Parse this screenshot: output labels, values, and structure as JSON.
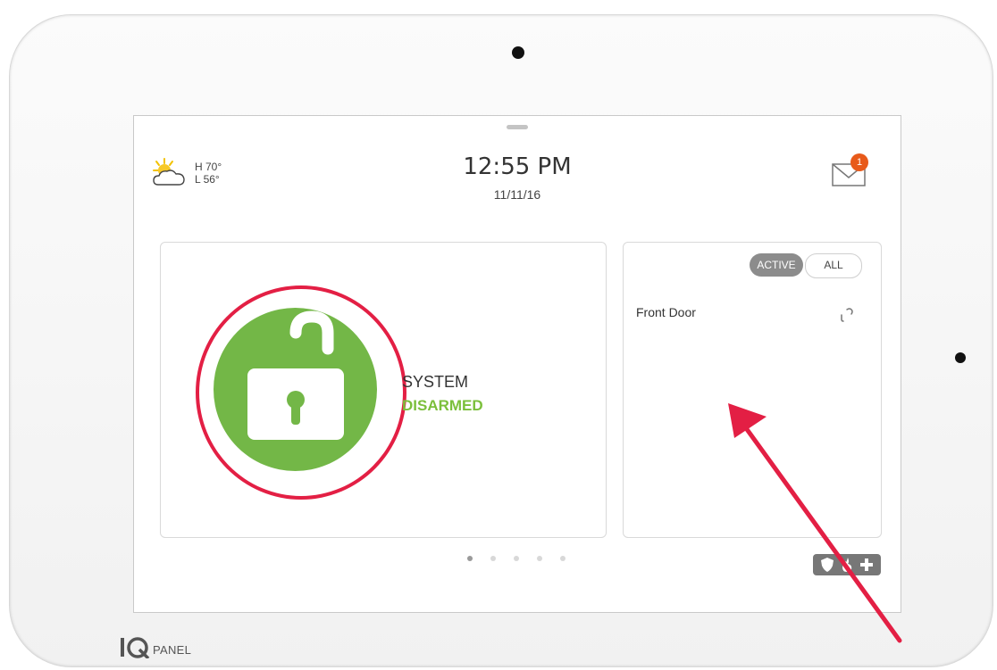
{
  "weather": {
    "icon": "partly-cloudy-icon",
    "high": "H 70°",
    "low": "L 56°"
  },
  "header": {
    "time": "12:55 PM",
    "date": "11/11/16"
  },
  "messages": {
    "icon": "mail-icon",
    "badge_count": "1"
  },
  "security": {
    "status_line1": "SYSTEM",
    "status_line2": "DISARMED",
    "lock_icon": "unlocked-padlock-icon",
    "status_color": "#73b747"
  },
  "sensors": {
    "filters": [
      "ACTIVE",
      "ALL"
    ],
    "selected_filter": "ACTIVE",
    "items": [
      {
        "name": "Front Door",
        "icon": "open-link-icon"
      }
    ]
  },
  "pagination": {
    "current_page": 1,
    "total_pages": 5
  },
  "emergency": {
    "icons": [
      "shield-icon",
      "fire-icon",
      "medical-cross-icon"
    ]
  },
  "brand": {
    "mark": "IQ",
    "name": "PANEL"
  },
  "annotations": {
    "highlight_color": "#e31f44"
  }
}
